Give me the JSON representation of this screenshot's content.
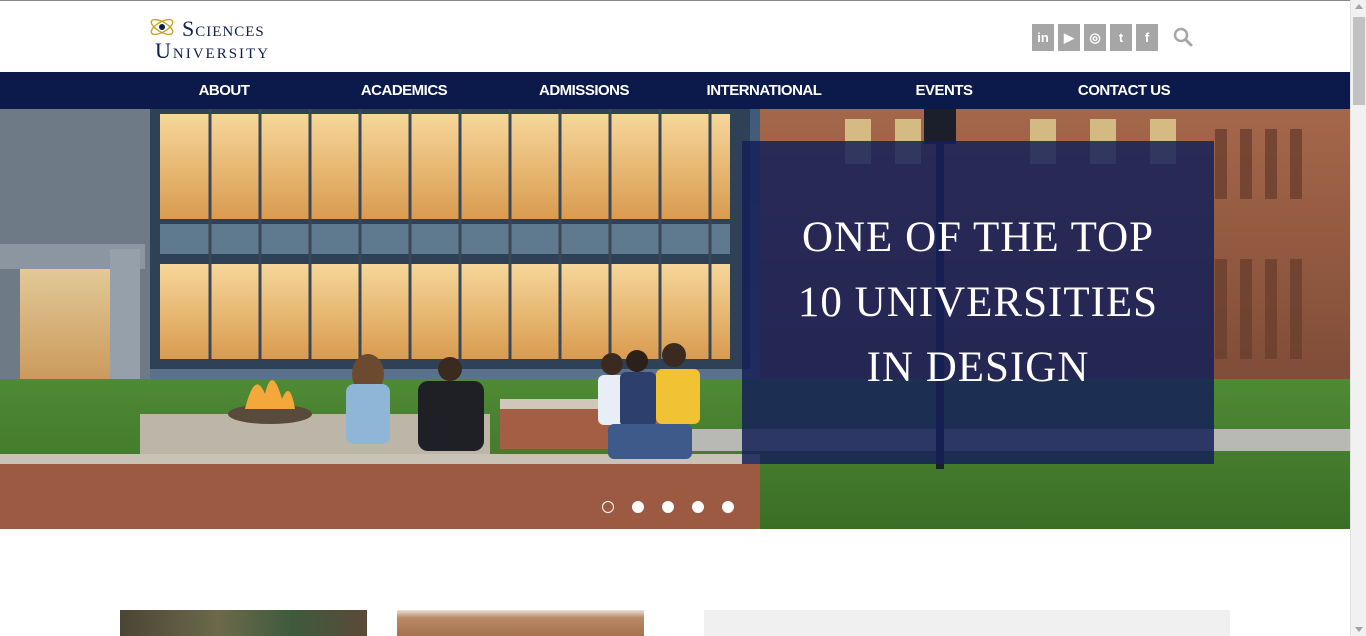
{
  "header": {
    "logo_line1": "Sciences",
    "logo_line2": "University",
    "social": [
      {
        "icon": "linkedin-icon",
        "glyph": "in"
      },
      {
        "icon": "youtube-icon",
        "glyph": "▶"
      },
      {
        "icon": "instagram-icon",
        "glyph": "◎"
      },
      {
        "icon": "twitter-icon",
        "glyph": "t"
      },
      {
        "icon": "facebook-icon",
        "glyph": "f"
      }
    ],
    "search_icon": "search-icon"
  },
  "nav": {
    "items": [
      {
        "label": "ABOUT"
      },
      {
        "label": "ACADEMICS"
      },
      {
        "label": "ADMISSIONS"
      },
      {
        "label": "INTERNATIONAL"
      },
      {
        "label": "EVENTS"
      },
      {
        "label": "CONTACT US"
      }
    ]
  },
  "hero": {
    "headline": "ONE OF THE TOP\n10 UNIVERSITIES\nIN DESIGN",
    "slide_count": 5,
    "active_slide": 1
  },
  "colors": {
    "nav_bg": "#0c1a4b",
    "brand_text": "#0f1f4d",
    "social_bg": "#a6a6a6",
    "overlay": "#142058"
  }
}
